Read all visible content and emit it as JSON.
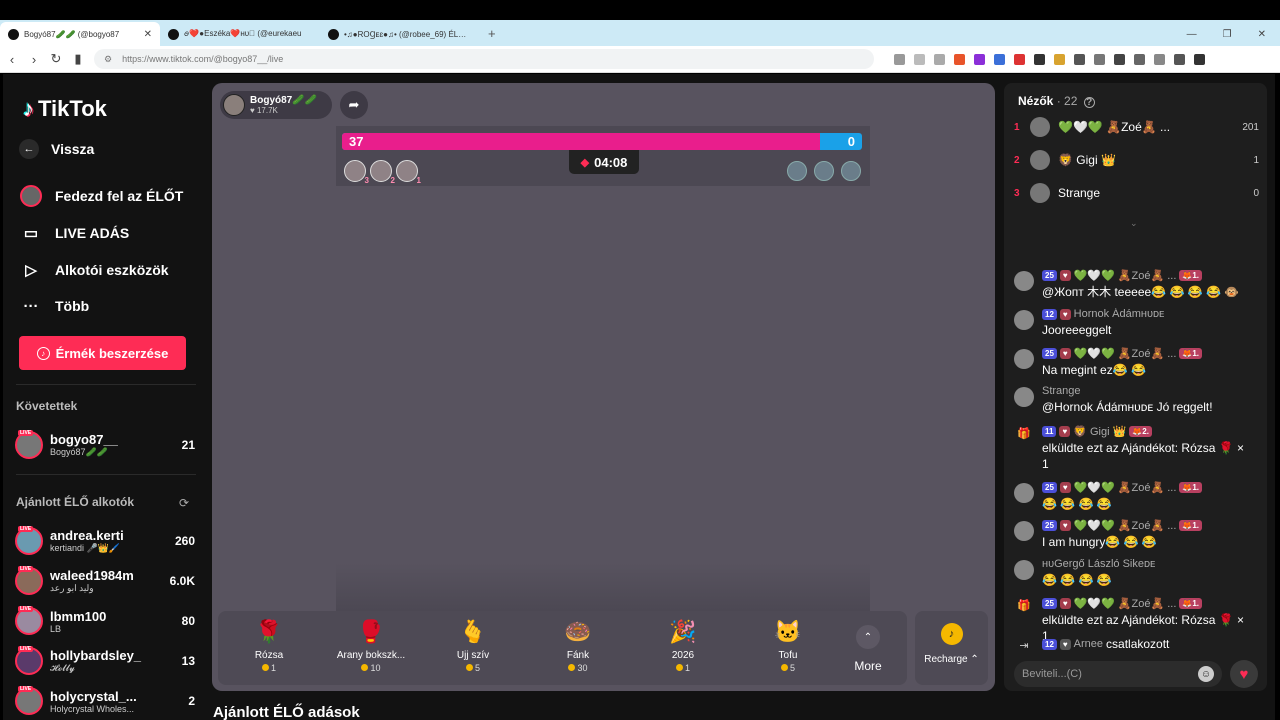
{
  "browser": {
    "tabs": [
      {
        "title": "Bogyó87🥒🥒 (@bogyo87",
        "active": true
      },
      {
        "title": "ꪮ❤️●Eszéka❤️ʜᴜ🏽 (@eurekaeu",
        "active": false
      },
      {
        "title": "•♫●ROꞬᴇɛ●♫• (@robee_69) ÉLŐ ...",
        "active": false
      }
    ],
    "url": "https://www.tiktok.com/@bogyo87__/live"
  },
  "sidebar": {
    "logo": "TikTok",
    "menu": [
      {
        "label": "Vissza",
        "icon": "back-arrow-icon"
      },
      {
        "label": "Fedezd fel az ÉLŐT",
        "icon": "explore-live-icon"
      },
      {
        "label": "LIVE ADÁS",
        "icon": "camera-icon"
      },
      {
        "label": "Alkotói eszközök",
        "icon": "play-icon"
      },
      {
        "label": "Több",
        "icon": "more-dots-icon"
      }
    ],
    "coin_button": "Érmék beszerzése",
    "following_title": "Követettek",
    "following": [
      {
        "name": "bogyo87__",
        "sub": "Bogyó87🥒🥒",
        "count": "21",
        "live": "LIVE"
      }
    ],
    "recommended_title": "Ajánlott ÉLŐ alkotók",
    "recommended": [
      {
        "name": "andrea.kerti",
        "sub": "kertiandi 🎤👑🖌️",
        "count": "260",
        "live": "LIVE"
      },
      {
        "name": "waleed1984m",
        "sub": "وليد ابو رعد",
        "count": "6.0K",
        "live": "LIVE"
      },
      {
        "name": "lbmm100",
        "sub": "LB",
        "count": "80",
        "live": "LIVE"
      },
      {
        "name": "hollybardsley_",
        "sub": "𝓗𝓸𝓵𝓵𝔂",
        "count": "13",
        "live": "LIVE"
      },
      {
        "name": "holycrystal_...",
        "sub": "Holycrystal Wholes...",
        "count": "2",
        "live": "LIVE"
      }
    ]
  },
  "stream": {
    "host_name": "Bogyó87🥒🥒",
    "host_likes": "♥ 17.7K",
    "battle": {
      "left_score": "37",
      "right_score": "0",
      "left_fraction": 0.92,
      "timer": "04:08"
    },
    "supporters": [
      "3",
      "2",
      "1"
    ],
    "gifts": [
      {
        "name": "Rózsa",
        "price": "1",
        "icon": "🌹"
      },
      {
        "name": "Arany bokszk...",
        "price": "10",
        "icon": "🥊"
      },
      {
        "name": "Ujj szív",
        "price": "5",
        "icon": "🫰"
      },
      {
        "name": "Fánk",
        "price": "30",
        "icon": "🍩"
      },
      {
        "name": "2026",
        "price": "1",
        "icon": "🎉"
      },
      {
        "name": "Tofu",
        "price": "5",
        "icon": "🐱"
      }
    ],
    "more_label": "More",
    "recharge_label": "Recharge ⌃",
    "recommended_heading": "Ajánlott ÉLŐ adások"
  },
  "chat": {
    "viewers_label": "Nézők",
    "viewers_count": "· 22",
    "top_viewers": [
      {
        "rank": "1",
        "name": "💚🤍💚 🧸Zoé🧸 ...",
        "score": "201"
      },
      {
        "rank": "2",
        "name": "🦁 Gigi 👑",
        "score": "1"
      },
      {
        "rank": "3",
        "name": "Strange",
        "score": "0"
      }
    ],
    "messages": [
      {
        "type": "user",
        "badges": [
          "25",
          "",
          "🦊1."
        ],
        "name": "💚🤍💚 🧸Zoé🧸 ...",
        "text": "@Жопт ⽊⽊ teeeee😂 😂 😂 😂 🐵"
      },
      {
        "type": "user",
        "badges": [
          "12",
          ""
        ],
        "name": "Hornok Ádámʜᴜᴅᴇ",
        "text": "Jooreeeggelt"
      },
      {
        "type": "user",
        "badges": [
          "25",
          "",
          "🦊1."
        ],
        "name": "💚🤍💚 🧸Zoé🧸 ...",
        "text": "Na megint ez😂 😂"
      },
      {
        "type": "user",
        "badges": [],
        "name": "Strange",
        "text": "@Hornok Ádámʜᴜᴅᴇ Jó reggelt!"
      },
      {
        "type": "gift",
        "badges": [
          "11",
          "",
          "🦊2."
        ],
        "name": "🦁 Gigi 👑",
        "text": "elküldte ezt az Ajándékot: Rózsa 🌹 × 1"
      },
      {
        "type": "user",
        "badges": [
          "25",
          "",
          "🦊1."
        ],
        "name": "💚🤍💚 🧸Zoé🧸 ...",
        "text": "😂 😂 😂 😂"
      },
      {
        "type": "user",
        "badges": [
          "25",
          "",
          "🦊1."
        ],
        "name": "💚🤍💚 🧸Zoé🧸 ...",
        "text": "I am hungry😂 😂 😂"
      },
      {
        "type": "user",
        "badges": [],
        "name": "ʜᴜGergő László Sikeᴅᴇ",
        "text": "😂 😂 😂 😂"
      },
      {
        "type": "gift",
        "badges": [
          "25",
          "",
          "🦊1."
        ],
        "name": "💚🤍💚 🧸Zoé🧸 ...",
        "text": "elküldte ezt az Ajándékot: Rózsa 🌹 × 1"
      },
      {
        "type": "join",
        "badges": [
          "12",
          ""
        ],
        "name": "Arnee",
        "text": "csatlakozott"
      }
    ],
    "input_placeholder": "Beviteli...(C)"
  }
}
